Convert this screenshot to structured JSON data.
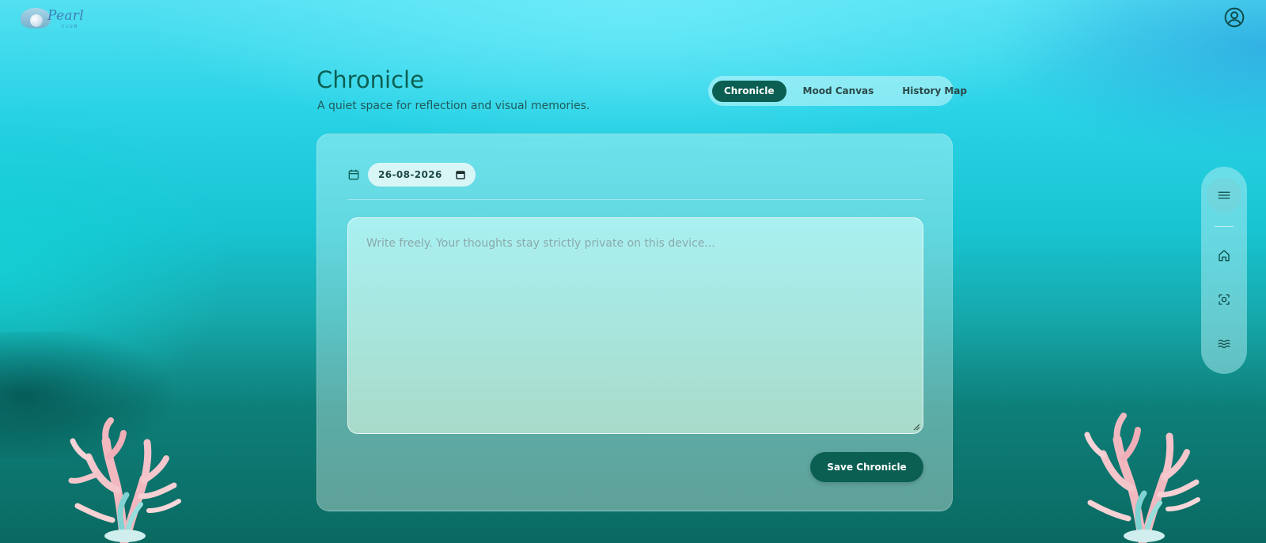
{
  "brand": {
    "name": "Pearl",
    "tagline": "CLUB"
  },
  "header": {
    "title": "Chronicle",
    "subtitle": "A quiet space for reflection and visual memories."
  },
  "tabs": [
    {
      "label": "Chronicle",
      "active": true
    },
    {
      "label": "Mood Canvas",
      "active": false
    },
    {
      "label": "History Map",
      "active": false
    }
  ],
  "entry": {
    "date_value": "26-08-2026",
    "placeholder": "Write freely. Your thoughts stay strictly private on this device...",
    "save_label": "Save Chronicle"
  },
  "side_nav": {
    "items": [
      {
        "icon": "menu-icon"
      },
      {
        "icon": "home-icon"
      },
      {
        "icon": "scan-icon"
      },
      {
        "icon": "waves-icon"
      }
    ]
  },
  "colors": {
    "accent": "#0b5f52",
    "tab_track": "#bef5fa",
    "text_dark": "#1f5a5a"
  }
}
